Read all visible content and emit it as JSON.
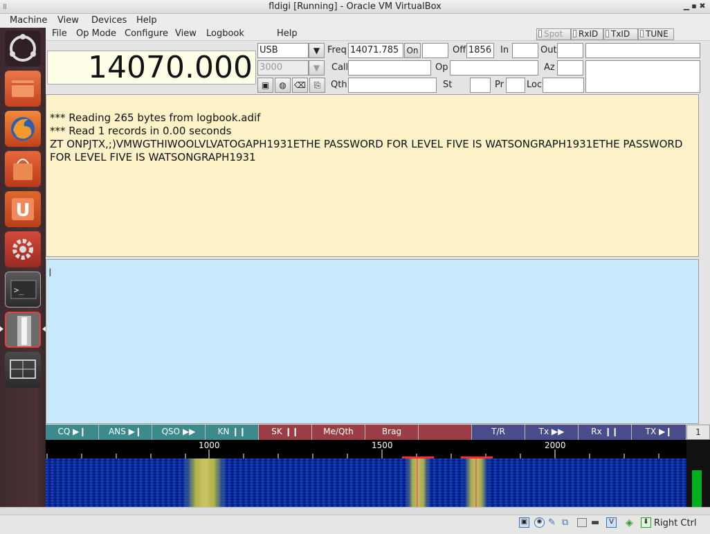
{
  "window": {
    "title": "fldigi [Running] - Oracle VM VirtualBox"
  },
  "vbox_menu": {
    "machine": "Machine",
    "view": "View",
    "devices": "Devices",
    "help": "Help"
  },
  "launcher": [
    "ubuntu-dash-icon",
    "files-icon",
    "firefox-icon",
    "software-center-icon",
    "ubuntu-one-icon",
    "settings-icon",
    "terminal-icon",
    "fldigi-icon",
    "workspace-icon"
  ],
  "fldigi_menu": {
    "file": "File",
    "op_mode": "Op Mode",
    "configure": "Configure",
    "view": "View",
    "logbook": "Logbook",
    "help": "Help"
  },
  "toggles": {
    "spot": "Spot",
    "rxid": "RxID",
    "txid": "TxID",
    "tune": "TUNE"
  },
  "freq_display": "14070.000",
  "mode": {
    "value": "USB",
    "bandwidth": "3000"
  },
  "labels": {
    "freq": "Freq",
    "on": "On",
    "off": "Off",
    "in": "In",
    "out": "Out",
    "call": "Call",
    "op": "Op",
    "az": "Az",
    "qth": "Qth",
    "st": "St",
    "pr": "Pr",
    "loc": "Loc"
  },
  "fields": {
    "freq": "14071.785",
    "off": "1856",
    "on": "",
    "in": "",
    "out": "",
    "call": "",
    "op": "",
    "az": "",
    "qth": "",
    "st": "",
    "pr": "",
    "loc": ""
  },
  "rx_text": [
    "*** Reading 265 bytes from logbook.adif",
    "*** Read 1 records in 0.00 seconds",
    "ZT ONPJTX,;)VMWGTHIWOOLVLVATOGAPH1931ETHE PASSWORD FOR LEVEL FIVE IS WATSONGRAPH1931ETHE PASSWORD FOR LEVEL FIVE IS WATSONGRAPH1931"
  ],
  "macros": [
    {
      "label": "CQ",
      "glyph": "▶❙",
      "color": "#3d8a8d"
    },
    {
      "label": "ANS",
      "glyph": "▶❙",
      "color": "#3d8a8d"
    },
    {
      "label": "QSO",
      "glyph": "▶▶",
      "color": "#3d8a8d"
    },
    {
      "label": "KN",
      "glyph": "❙❙",
      "color": "#3d8a8d"
    },
    {
      "label": "SK",
      "glyph": "❙❙",
      "color": "#9b3d44"
    },
    {
      "label": "Me/Qth",
      "glyph": "",
      "color": "#9b3d44"
    },
    {
      "label": "Brag",
      "glyph": "",
      "color": "#9b3d44"
    },
    {
      "label": "",
      "glyph": "",
      "color": "#9b3d44"
    },
    {
      "label": "T/R",
      "glyph": "",
      "color": "#4b4c8c"
    },
    {
      "label": "Tx",
      "glyph": "▶▶",
      "color": "#4b4c8c"
    },
    {
      "label": "Rx",
      "glyph": "❙❙",
      "color": "#4b4c8c"
    },
    {
      "label": "TX",
      "glyph": "▶❙",
      "color": "#4b4c8c"
    }
  ],
  "macro_page": "1",
  "scale": [
    "1000",
    "1500",
    "2000"
  ],
  "statusbar": {
    "host_key": "Right Ctrl"
  }
}
